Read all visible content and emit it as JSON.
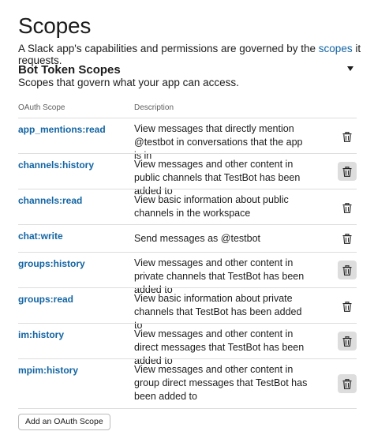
{
  "page": {
    "title": "Scopes",
    "description_prefix": "A Slack app's capabilities and permissions are governed by the ",
    "description_link": "scopes",
    "description_suffix": " it requests."
  },
  "section": {
    "title": "Bot Token Scopes",
    "subtitle": "Scopes that govern what your app can access.",
    "toggle_icon": "caret-down-icon"
  },
  "table": {
    "columns": [
      "OAuth Scope",
      "Description"
    ],
    "rows": [
      {
        "scope": "app_mentions:read",
        "description": "View messages that directly mention @testbot in conversations that the app is in",
        "delete_icon": "trash-icon"
      },
      {
        "scope": "channels:history",
        "description": "View messages and other content in public channels that TestBot has been added to",
        "delete_icon": "trash-icon"
      },
      {
        "scope": "channels:read",
        "description": "View basic information about public channels in the workspace",
        "delete_icon": "trash-icon"
      },
      {
        "scope": "chat:write",
        "description": "Send messages as @testbot",
        "delete_icon": "trash-icon"
      },
      {
        "scope": "groups:history",
        "description": "View messages and other content in private channels that TestBot has been added to",
        "delete_icon": "trash-icon"
      },
      {
        "scope": "groups:read",
        "description": "View basic information about private channels that TestBot has been added to",
        "delete_icon": "trash-icon"
      },
      {
        "scope": "im:history",
        "description": "View messages and other content in direct messages that TestBot has been added to",
        "delete_icon": "trash-icon"
      },
      {
        "scope": "mpim:history",
        "description": "View messages and other content in group direct messages that TestBot has been added to",
        "delete_icon": "trash-icon"
      }
    ]
  },
  "add_button": {
    "label": "Add an OAuth Scope"
  },
  "colors": {
    "link": "#1264a3",
    "text": "#1d1c1d",
    "muted": "#616061",
    "border": "#dddddd"
  }
}
